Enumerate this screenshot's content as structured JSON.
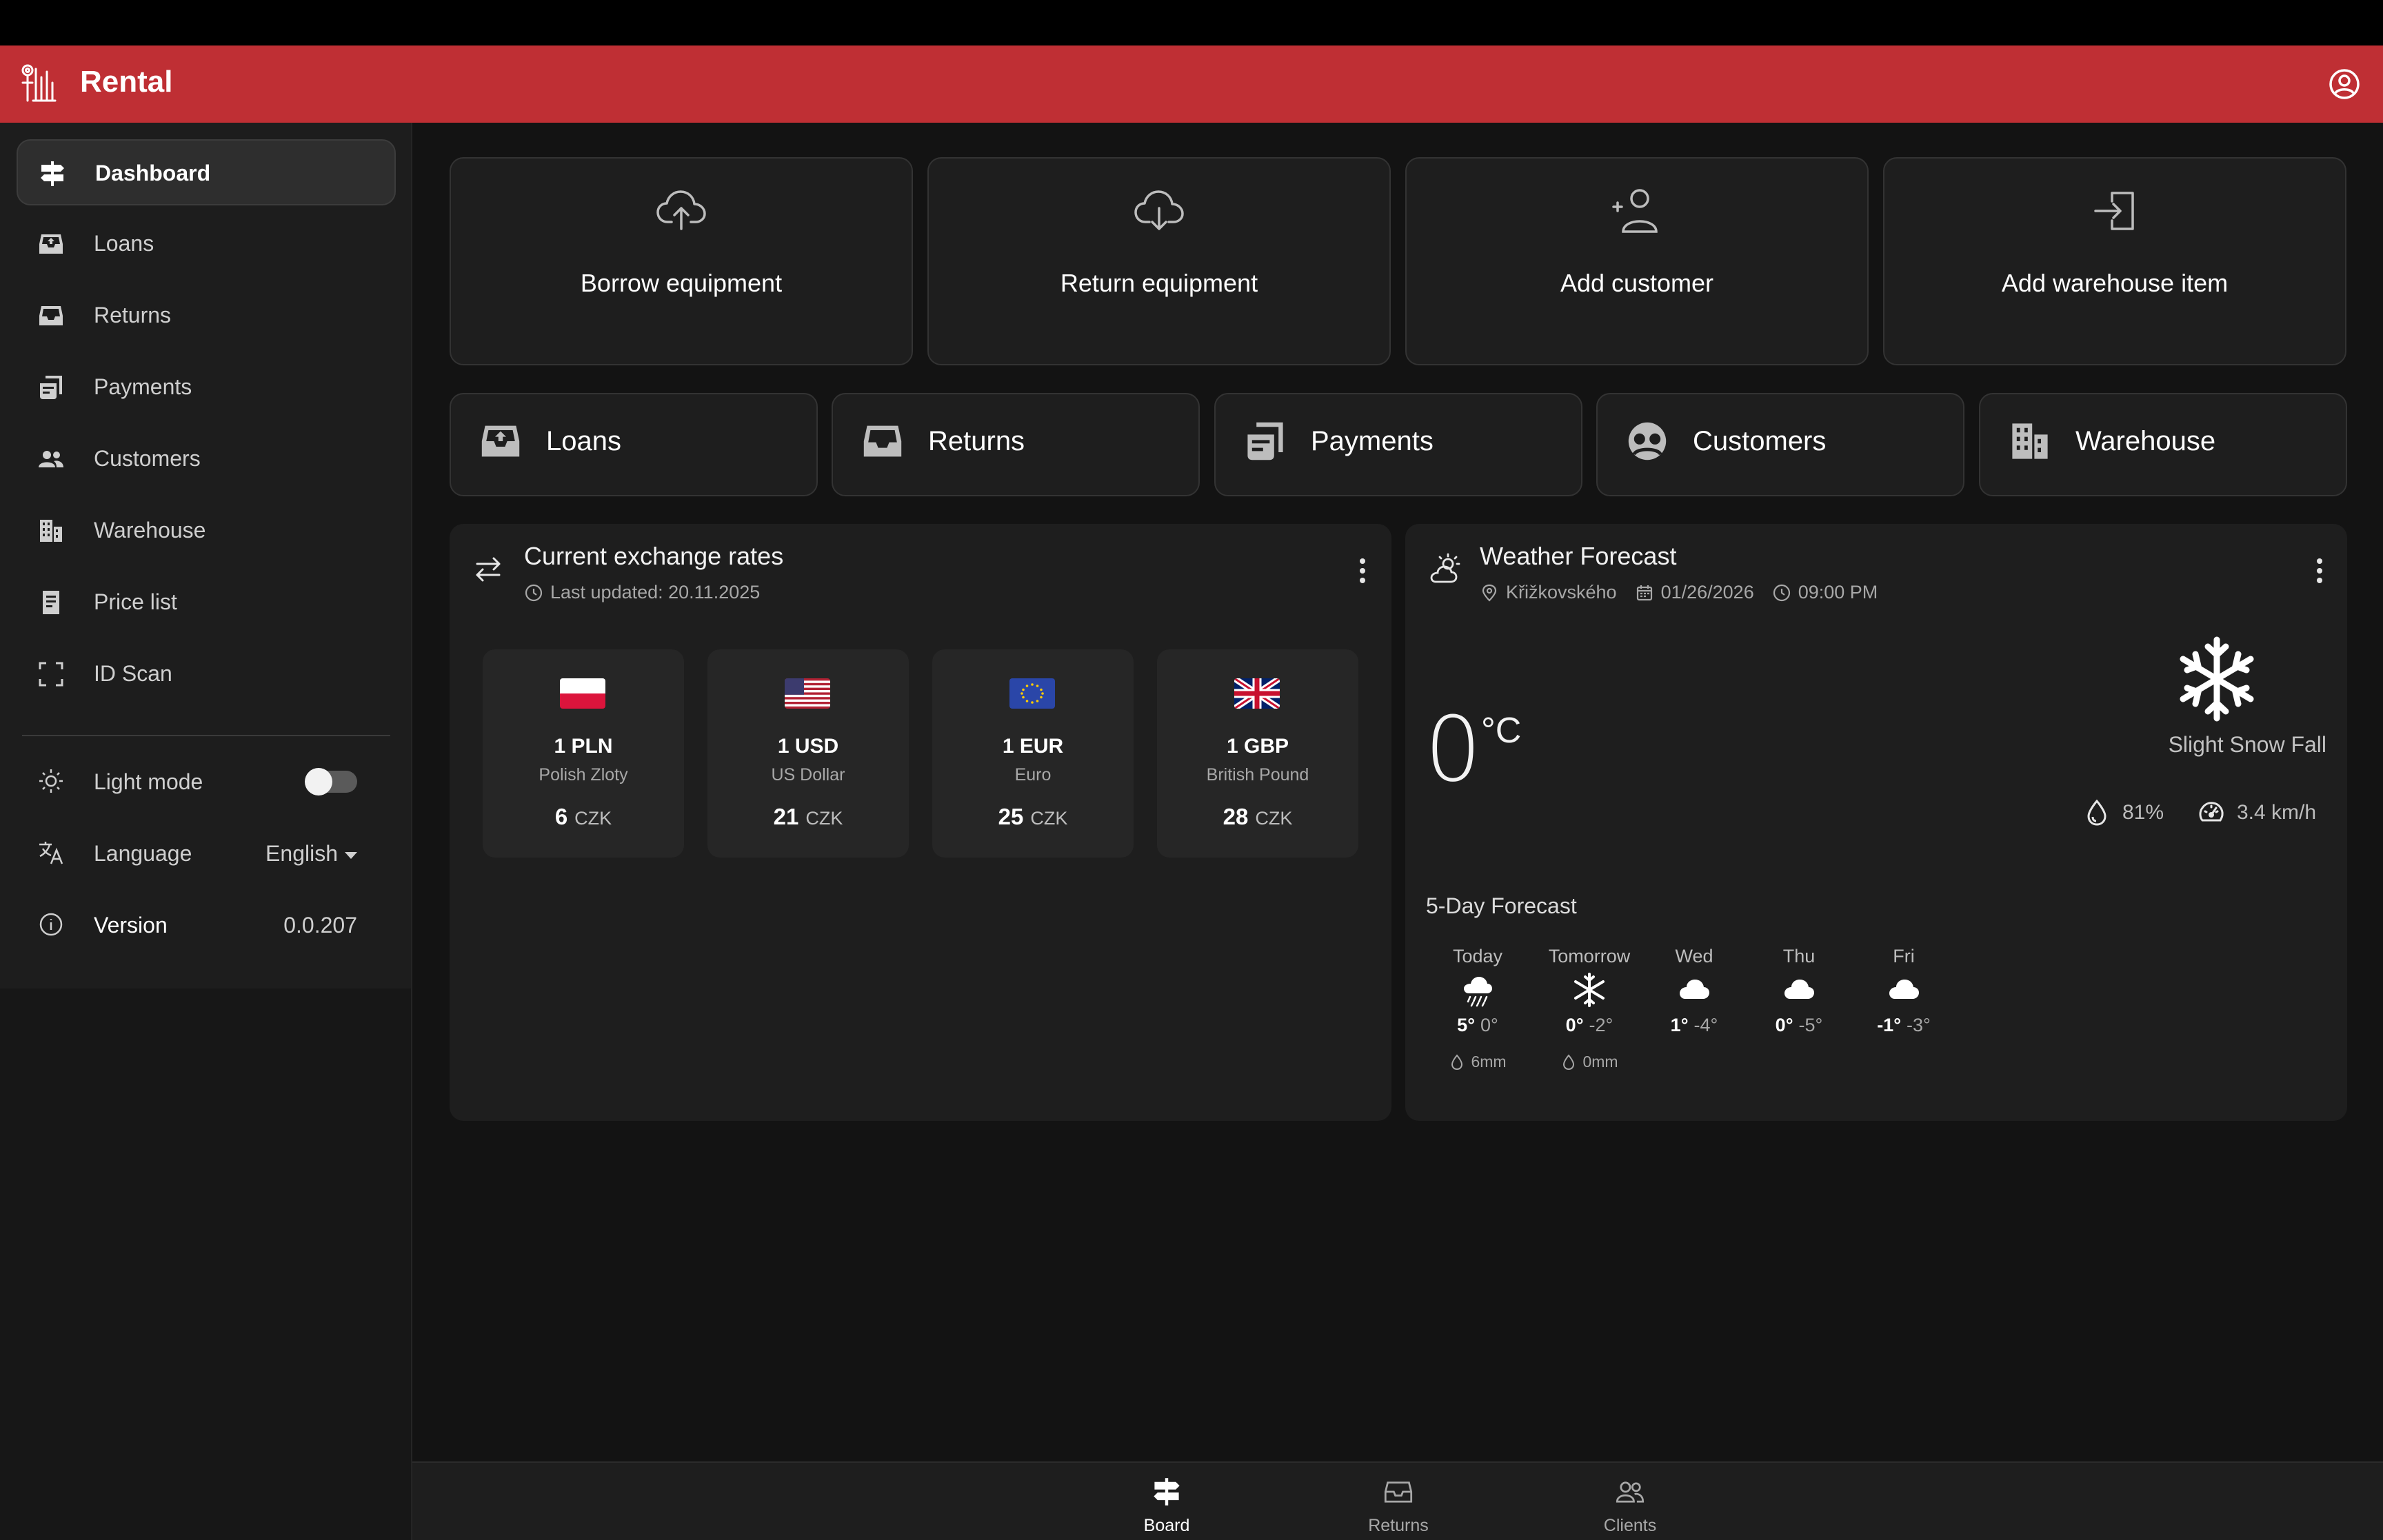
{
  "app": {
    "title": "Rental"
  },
  "sidebar": {
    "items": [
      {
        "label": "Dashboard",
        "icon": "signpost-icon",
        "active": true
      },
      {
        "label": "Loans",
        "icon": "inbox-upload-icon"
      },
      {
        "label": "Returns",
        "icon": "inbox-icon"
      },
      {
        "label": "Payments",
        "icon": "receipt-icon"
      },
      {
        "label": "Customers",
        "icon": "people-icon"
      },
      {
        "label": "Warehouse",
        "icon": "building-icon"
      },
      {
        "label": "Price list",
        "icon": "document-icon"
      },
      {
        "label": "ID Scan",
        "icon": "scan-frame-icon"
      }
    ],
    "settings": {
      "light_mode_label": "Light mode",
      "language_label": "Language",
      "language_value": "English",
      "version_label": "Version",
      "version_value": "0.0.207"
    }
  },
  "actions": [
    {
      "label": "Borrow equipment",
      "icon": "cloud-upload-icon"
    },
    {
      "label": "Return equipment",
      "icon": "cloud-download-icon"
    },
    {
      "label": "Add customer",
      "icon": "person-add-icon"
    },
    {
      "label": "Add warehouse item",
      "icon": "login-box-icon"
    }
  ],
  "shortcuts": [
    {
      "label": "Loans",
      "icon": "inbox-upload-icon"
    },
    {
      "label": "Returns",
      "icon": "inbox-icon"
    },
    {
      "label": "Payments",
      "icon": "receipt-icon"
    },
    {
      "label": "Customers",
      "icon": "customers-face-icon"
    },
    {
      "label": "Warehouse",
      "icon": "building-icon"
    }
  ],
  "exchange": {
    "title": "Current exchange rates",
    "updated": "Last updated: 20.11.2025",
    "rates": [
      {
        "code": "1 PLN",
        "name": "Polish Zloty",
        "value": "6",
        "currency": "CZK",
        "flag": "pl-flag-icon"
      },
      {
        "code": "1 USD",
        "name": "US Dollar",
        "value": "21",
        "currency": "CZK",
        "flag": "us-flag-icon"
      },
      {
        "code": "1 EUR",
        "name": "Euro",
        "value": "25",
        "currency": "CZK",
        "flag": "eu-flag-icon"
      },
      {
        "code": "1 GBP",
        "name": "British Pound",
        "value": "28",
        "currency": "CZK",
        "flag": "gb-flag-icon"
      }
    ]
  },
  "weather": {
    "title": "Weather Forecast",
    "location": "Křižkovského",
    "date": "01/26/2026",
    "time": "09:00 PM",
    "temperature": "0",
    "unit": "°C",
    "condition": "Slight Snow Fall",
    "humidity": "81%",
    "wind": "3.4 km/h",
    "forecast_title": "5-Day Forecast",
    "forecast": [
      {
        "day": "Today",
        "high": "5°",
        "low": "0°",
        "rain": "6mm",
        "icon": "rain-cloud-icon"
      },
      {
        "day": "Tomorrow",
        "high": "0°",
        "low": "-2°",
        "rain": "0mm",
        "icon": "snowflake-icon"
      },
      {
        "day": "Wed",
        "high": "1°",
        "low": "-4°",
        "icon": "cloud-icon"
      },
      {
        "day": "Thu",
        "high": "0°",
        "low": "-5°",
        "icon": "cloud-icon"
      },
      {
        "day": "Fri",
        "high": "-1°",
        "low": "-3°",
        "icon": "cloud-icon"
      }
    ]
  },
  "bottom_nav": [
    {
      "label": "Board",
      "icon": "signpost-icon",
      "active": true
    },
    {
      "label": "Returns",
      "icon": "inbox-icon"
    },
    {
      "label": "Clients",
      "icon": "people-outline-icon"
    }
  ],
  "colors": {
    "brand": "#bf2f34",
    "background": "#131313",
    "card": "#1e1e1e"
  }
}
